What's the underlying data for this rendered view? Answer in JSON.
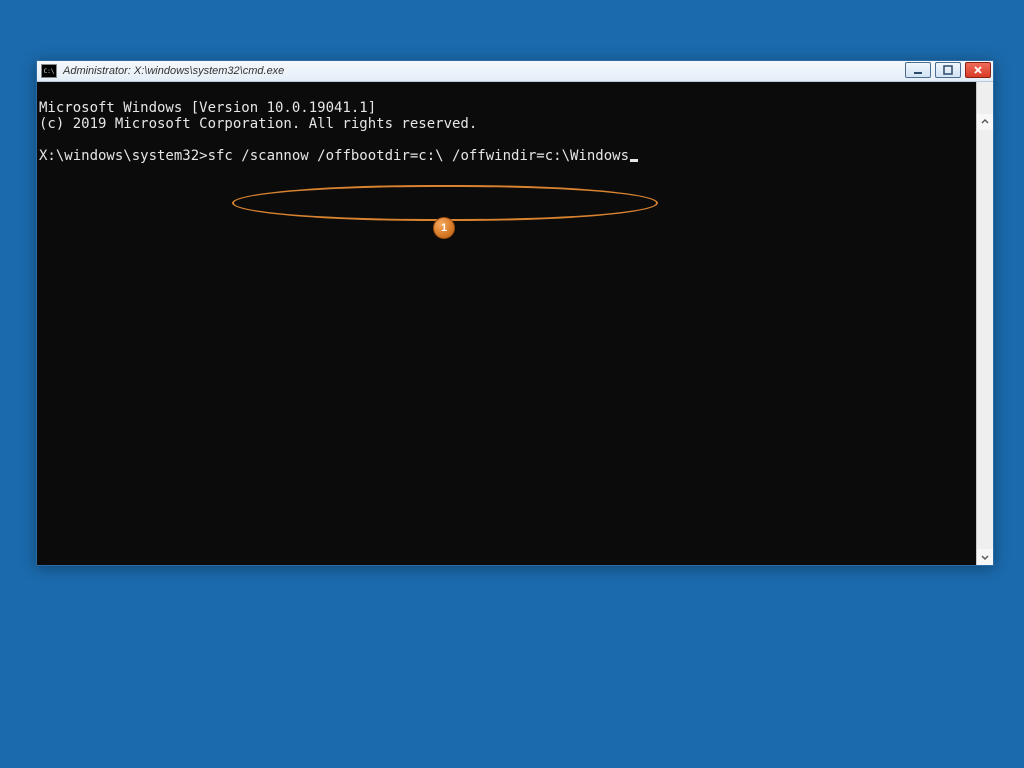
{
  "window": {
    "title": "Administrator: X:\\windows\\system32\\cmd.exe"
  },
  "terminal": {
    "lines": [
      "Microsoft Windows [Version 10.0.19041.1]",
      "(c) 2019 Microsoft Corporation. All rights reserved.",
      ""
    ],
    "prompt": "X:\\windows\\system32>",
    "command": "sfc /scannow /offbootdir=c:\\ /offwindir=c:\\Windows"
  },
  "annotation": {
    "badge": "1"
  }
}
